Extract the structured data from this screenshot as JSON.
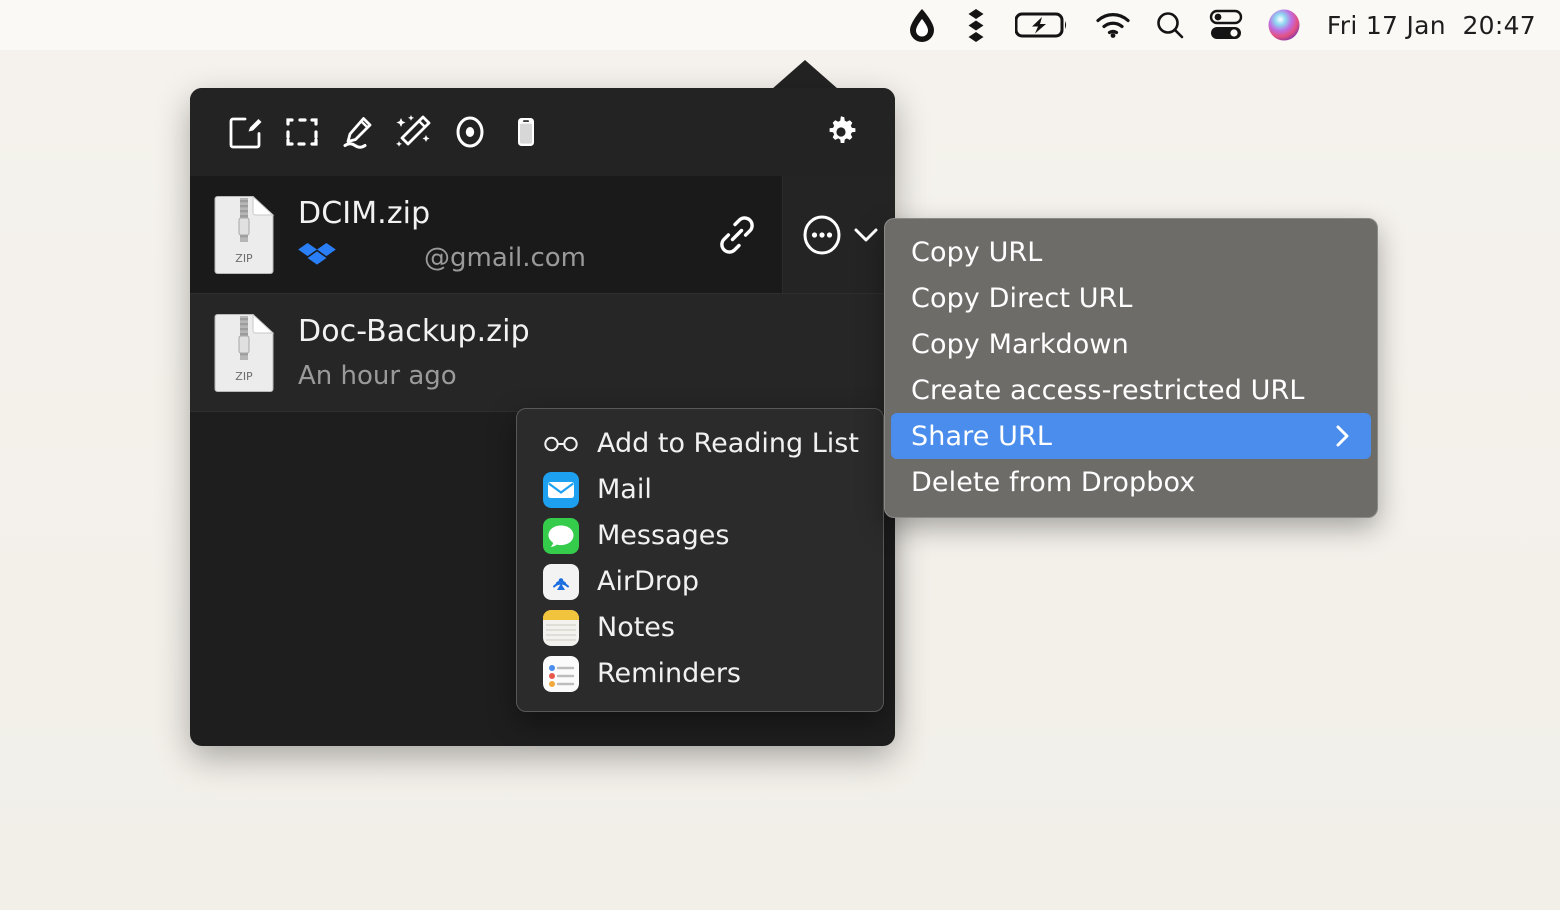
{
  "menubar": {
    "icons": [
      {
        "name": "flameshot-droplet-icon",
        "glyph": "droplet"
      },
      {
        "name": "dropbox-menu-icon",
        "glyph": "dropbox-diamonds"
      },
      {
        "name": "battery-charging-icon",
        "glyph": "battery"
      },
      {
        "name": "wifi-icon",
        "glyph": "wifi"
      },
      {
        "name": "spotlight-search-icon",
        "glyph": "search"
      },
      {
        "name": "control-center-icon",
        "glyph": "toggles"
      },
      {
        "name": "siri-icon",
        "glyph": "orb"
      }
    ],
    "clock": "Fri 17 Jan  20:47"
  },
  "panel": {
    "toolbar": [
      {
        "name": "new-note-button",
        "icon": "compose-icon"
      },
      {
        "name": "select-area-button",
        "icon": "selection-rect-icon"
      },
      {
        "name": "annotate-button",
        "icon": "pen-highlight-icon"
      },
      {
        "name": "magic-wand-button",
        "icon": "magic-wand-icon"
      },
      {
        "name": "record-button",
        "icon": "record-circle-icon"
      },
      {
        "name": "device-capture-button",
        "icon": "iphone-icon"
      }
    ],
    "settings_button": {
      "name": "settings-gear-button",
      "icon": "gear-icon"
    },
    "files": [
      {
        "name": "DCIM.zip",
        "subtitle": "@gmail.com",
        "badge": "dropbox-icon",
        "filetype_label": "ZIP",
        "selected": true,
        "has_link_button": true,
        "has_more_button": true
      },
      {
        "name": "Doc-Backup.zip",
        "subtitle": "An hour ago",
        "badge": null,
        "filetype_label": "ZIP",
        "selected": false,
        "has_link_button": false,
        "has_more_button": false
      }
    ]
  },
  "context_menu": {
    "items": [
      {
        "label": "Copy URL",
        "highlighted": false,
        "submenu": false
      },
      {
        "label": "Copy Direct URL",
        "highlighted": false,
        "submenu": false
      },
      {
        "label": "Copy Markdown",
        "highlighted": false,
        "submenu": false
      },
      {
        "label": "Create access-restricted URL",
        "highlighted": false,
        "submenu": false
      },
      {
        "label": "Share URL",
        "highlighted": true,
        "submenu": true
      },
      {
        "label": "Delete from Dropbox",
        "highlighted": false,
        "submenu": false
      }
    ]
  },
  "share_submenu": {
    "items": [
      {
        "label": "Add to Reading List",
        "icon": "reading-glasses-icon"
      },
      {
        "label": "Mail",
        "icon": "mail-app-icon"
      },
      {
        "label": "Messages",
        "icon": "messages-app-icon"
      },
      {
        "label": "AirDrop",
        "icon": "airdrop-app-icon"
      },
      {
        "label": "Notes",
        "icon": "notes-app-icon"
      },
      {
        "label": "Reminders",
        "icon": "reminders-app-icon"
      }
    ]
  },
  "colors": {
    "desktop_background": "#f5f2ed",
    "menubar_background": "#fbf9f5",
    "panel_background": "#1e1e1e",
    "panel_toolbar": "#232323",
    "context_menu_background": "#6d6c69",
    "submenu_background": "#2b2b2b",
    "highlight_blue": "#4a8ded",
    "dropbox_blue": "#2a7ff7"
  }
}
